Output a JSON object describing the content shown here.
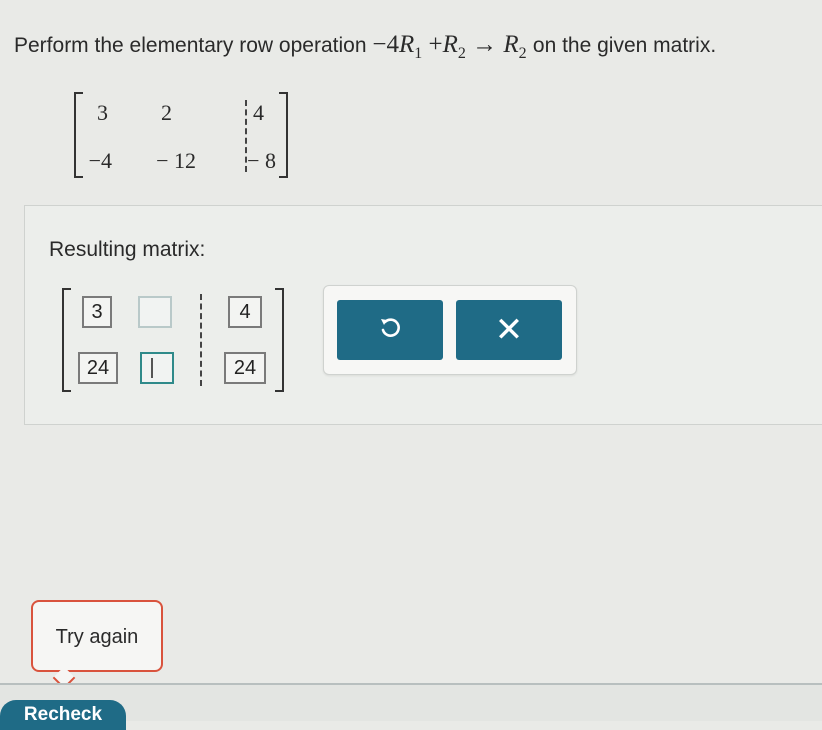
{
  "question": {
    "prefix": "Perform the elementary row operation",
    "op_coef": "−4",
    "r_letter": "R",
    "r1_sub": "1",
    "plus": "+",
    "r2_sub": "2",
    "arrow": "→",
    "target_sub": "2",
    "suffix": "on the given matrix."
  },
  "given_matrix": {
    "row1": [
      "3",
      "2",
      "4"
    ],
    "row2": [
      "−4",
      "− 12",
      "− 8"
    ]
  },
  "result": {
    "label": "Resulting matrix:",
    "row1": [
      "3",
      "",
      "4"
    ],
    "row2": [
      "24",
      "",
      "24"
    ]
  },
  "actions": {
    "undo_icon": "undo-icon",
    "clear_symbol": "✕"
  },
  "feedback": {
    "try_again": "Try again"
  },
  "footer": {
    "recheck_label": "Recheck"
  }
}
